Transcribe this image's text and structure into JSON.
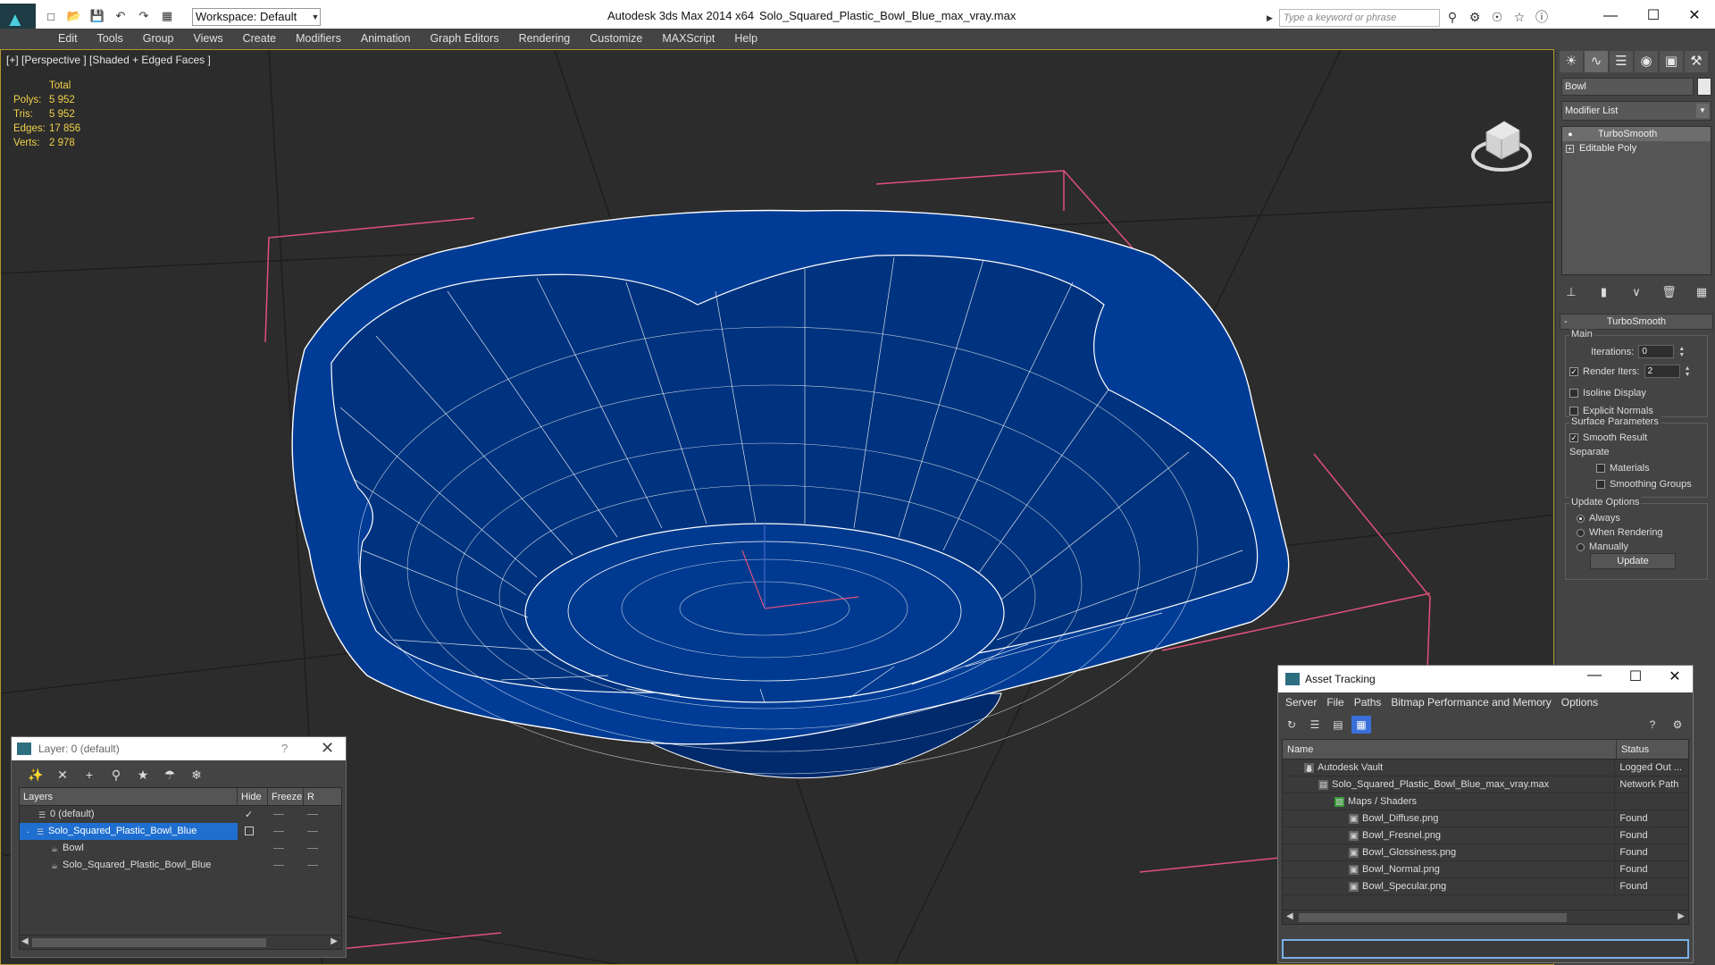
{
  "window": {
    "app_title": "Autodesk 3ds Max  2014 x64",
    "file_title": "Solo_Squared_Plastic_Bowl_Blue_max_vray.max",
    "workspace": "Workspace: Default",
    "search_placeholder": "Type a keyword or phrase",
    "minimize": "—",
    "maximize": "☐",
    "close": "✕"
  },
  "menu": [
    "Edit",
    "Tools",
    "Group",
    "Views",
    "Create",
    "Modifiers",
    "Animation",
    "Graph Editors",
    "Rendering",
    "Customize",
    "MAXScript",
    "Help"
  ],
  "viewport": {
    "label": "[+] [Perspective ] [Shaded + Edged Faces ]",
    "stats": {
      "header": "Total",
      "rows": [
        {
          "k": "Polys:",
          "v": "5 952"
        },
        {
          "k": "Tris:",
          "v": "5 952"
        },
        {
          "k": "Edges:",
          "v": "17 856"
        },
        {
          "k": "Verts:",
          "v": "2 978"
        }
      ]
    },
    "colors": {
      "mesh": "#003c96",
      "wire": "#ffffff",
      "bbox": "#e0507a",
      "selected_border": "#b39630"
    }
  },
  "command_panel": {
    "object_name": "Bowl",
    "modifier_list": "Modifier List",
    "stack": [
      {
        "label": "TurboSmooth",
        "selected": true
      },
      {
        "label": "Editable Poly",
        "selected": false
      }
    ],
    "turbosmooth": {
      "title": "TurboSmooth",
      "main_label": "Main",
      "iterations_label": "Iterations:",
      "iterations": "0",
      "render_iters_label": "Render Iters:",
      "render_iters": "2",
      "isoline": "Isoline Display",
      "explicit": "Explicit Normals",
      "surface_label": "Surface Parameters",
      "smooth_result": "Smooth Result",
      "separate_label": "Separate",
      "materials": "Materials",
      "smoothing_groups": "Smoothing Groups",
      "update_label": "Update Options",
      "always": "Always",
      "when_rendering": "When Rendering",
      "manually": "Manually",
      "update_button": "Update"
    }
  },
  "layer_dialog": {
    "title": "Layer: 0 (default)",
    "help": "?",
    "close": "✕",
    "columns": [
      "Layers",
      "Hide",
      "Freeze",
      "R"
    ],
    "rows": [
      {
        "label": "0 (default)",
        "indent": 1,
        "selected": false
      },
      {
        "label": "Solo_Squared_Plastic_Bowl_Blue",
        "indent": 1,
        "selected": true
      },
      {
        "label": "Bowl",
        "indent": 2,
        "selected": false
      },
      {
        "label": "Solo_Squared_Plastic_Bowl_Blue",
        "indent": 2,
        "selected": false
      }
    ]
  },
  "asset_dialog": {
    "title": "Asset Tracking",
    "menu": [
      "Server",
      "File",
      "Paths",
      "Bitmap Performance and Memory",
      "Options"
    ],
    "columns": [
      "Name",
      "Status"
    ],
    "rows": [
      {
        "name": "Autodesk Vault",
        "status": "Logged Out ...",
        "indent": 1
      },
      {
        "name": "Solo_Squared_Plastic_Bowl_Blue_max_vray.max",
        "status": "Network Path",
        "indent": 2
      },
      {
        "name": "Maps / Shaders",
        "status": "",
        "indent": 3
      },
      {
        "name": "Bowl_Diffuse.png",
        "status": "Found",
        "indent": 4
      },
      {
        "name": "Bowl_Fresnel.png",
        "status": "Found",
        "indent": 4
      },
      {
        "name": "Bowl_Glossiness.png",
        "status": "Found",
        "indent": 4
      },
      {
        "name": "Bowl_Normal.png",
        "status": "Found",
        "indent": 4
      },
      {
        "name": "Bowl_Specular.png",
        "status": "Found",
        "indent": 4
      }
    ]
  }
}
